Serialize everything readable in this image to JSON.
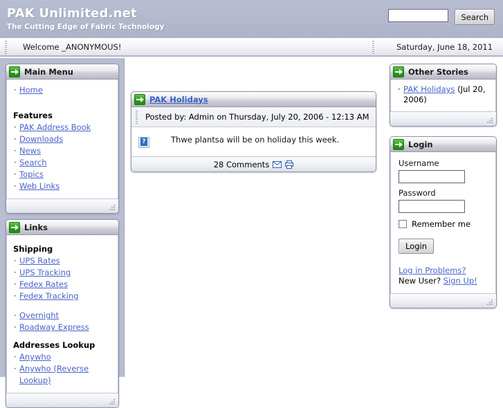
{
  "banner": {
    "site_title": "PAK Unlimited.net",
    "tagline": "The Cutting Edge of Fabric Technology",
    "search": {
      "value": "",
      "placeholder": "",
      "button_label": "Search",
      "icon": "search-icon"
    }
  },
  "userbar": {
    "welcome": "Welcome _ANONYMOUS!",
    "date": "Saturday, June 18, 2011"
  },
  "left_column": {
    "blocks": [
      {
        "title": "Main Menu",
        "icon": "green-arrow-icon",
        "items": [
          {
            "type": "link",
            "label": "Home"
          },
          {
            "type": "spacer",
            "label": ""
          },
          {
            "type": "heading",
            "label": "Features"
          },
          {
            "type": "link",
            "label": "PAK Address Book"
          },
          {
            "type": "link",
            "label": "Downloads"
          },
          {
            "type": "link",
            "label": "News"
          },
          {
            "type": "link",
            "label": "Search"
          },
          {
            "type": "link",
            "label": "Topics"
          },
          {
            "type": "link",
            "label": "Web Links"
          }
        ]
      },
      {
        "title": "Links",
        "icon": "green-arrow-icon",
        "items": [
          {
            "type": "heading",
            "label": "Shipping"
          },
          {
            "type": "link",
            "label": "UPS Rates"
          },
          {
            "type": "link",
            "label": "UPS Tracking"
          },
          {
            "type": "link",
            "label": "Fedex Rates"
          },
          {
            "type": "link",
            "label": "Fedex Tracking"
          },
          {
            "type": "spacer",
            "label": ""
          },
          {
            "type": "link",
            "label": "Overnight"
          },
          {
            "type": "link",
            "label": "Roadway Express"
          },
          {
            "type": "heading",
            "label": "Addresses Lookup"
          },
          {
            "type": "link",
            "label": "Anywho"
          },
          {
            "type": "link",
            "label": "Anywho (Reverse Lookup)"
          }
        ]
      }
    ]
  },
  "center_column": {
    "article": {
      "title": "PAK Holidays",
      "icon": "green-arrow-icon",
      "posted_by": "Posted by: Admin on Thursday, July 20, 2006 - 12:13 AM",
      "body_text": "Thwe plantsa will be on holiday this week.",
      "body_image": "broken-image-icon",
      "comments_label": "28 Comments",
      "mail_icon": "envelope-icon",
      "print_icon": "printer-icon"
    }
  },
  "right_column": {
    "other_stories": {
      "title": "Other Stories",
      "icon": "green-arrow-icon",
      "items": [
        {
          "link": "PAK Holidays",
          "meta": " (Jul 20, 2006)"
        }
      ]
    },
    "login": {
      "title": "Login",
      "icon": "green-arrow-icon",
      "username_label": "Username",
      "username_value": "",
      "password_label": "Password",
      "password_value": "",
      "remember_label": "Remember me",
      "remember_checked": false,
      "login_button": "Login",
      "help_link": "Log in Problems?",
      "new_user_text": "New User? ",
      "signup_link": "Sign Up!"
    }
  },
  "colors": {
    "banner_bg": "#b3b8ce",
    "left_col_bg": "#b8bdd1",
    "link": "#4a63c8",
    "arrow_green": "#2e9e18",
    "block_border": "#8e93a8"
  }
}
